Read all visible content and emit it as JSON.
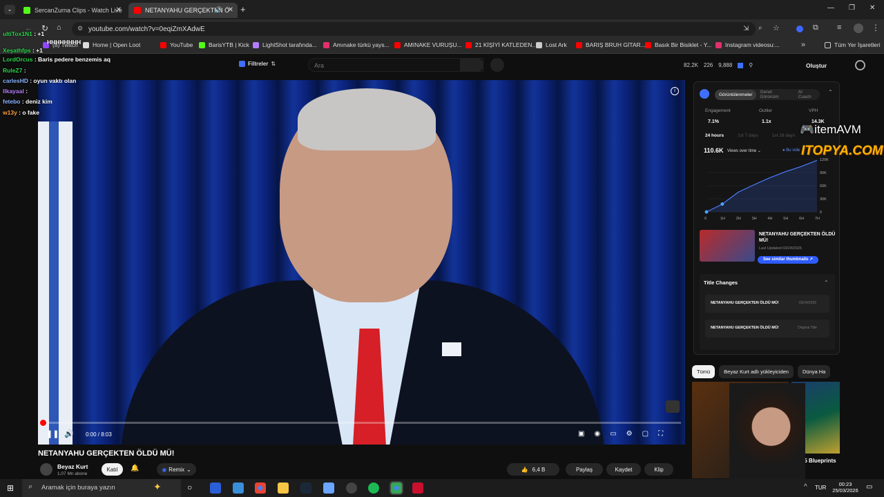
{
  "tabs": [
    {
      "title": "SercanZurna Clips - Watch Live"
    },
    {
      "title": "NETANYAHU GERÇEKTEN Ö"
    }
  ],
  "address": {
    "url": "youtube.com/watch?v=0eqiZmXAdwE"
  },
  "bookmarks": [
    {
      "label": "(8) Twitch",
      "color": "#9146ff"
    },
    {
      "label": "Home | Open Loot",
      "color": "#dddddd"
    },
    {
      "label": "YouTube",
      "color": "#ff0000"
    },
    {
      "label": "BarisYTB | Kick",
      "color": "#53fc18"
    },
    {
      "label": "LightShot tarafında...",
      "color": "#b57cff"
    },
    {
      "label": "Amınake türkü yays...",
      "color": "#e1306c"
    },
    {
      "label": "AMINAKE VURUŞU...",
      "color": "#ff0000"
    },
    {
      "label": "21 KİŞİYİ KATLEDEN...",
      "color": "#ff0000"
    },
    {
      "label": "Lost Ark",
      "color": "#cccccc"
    },
    {
      "label": "BARIŞ BRUH GİTAR...",
      "color": "#ff0000"
    },
    {
      "label": "Basık Bir Bisiklet - Y...",
      "color": "#ff0000"
    },
    {
      "label": "Instagram videosu:...",
      "color": "#e1306c"
    }
  ],
  "bookmarks_all": "Tüm Yer İşaretleri",
  "chat": [
    {
      "user": "ultiTox1N1",
      "msg": " : +1",
      "color": "#2bd44b"
    },
    {
      "user": "",
      "msg": "HHHHHHHH",
      "color": "#ffffff"
    },
    {
      "user": "Xeşathfps",
      "msg": " : +1",
      "color": "#2bd44b"
    },
    {
      "user": "LordOrcus",
      "msg": " : Baris pedere benzemis aq",
      "color": "#2bd44b"
    },
    {
      "user": "RuleZ7",
      "msg": " :",
      "color": "#2bd44b"
    },
    {
      "user": "carlesHD",
      "msg": " : oyun vaktı olan",
      "color": "#8ab4ff"
    },
    {
      "user": "llkayaal",
      "msg": " :",
      "color": "#b47cff"
    },
    {
      "user": "fetebo",
      "msg": " : deniz kim",
      "color": "#8ab4ff"
    },
    {
      "user": "w13y",
      "msg": " : o fake",
      "color": "#ff9f3a"
    }
  ],
  "yt": {
    "filters": "Filtreler",
    "search_placeholder": "Ara",
    "stats": [
      "82.2K",
      "226",
      "9,888"
    ],
    "create": "Oluştur",
    "time": "0:00 / 8:03",
    "title": "NETANYAHU GERÇEKTEN ÖLDÜ MÜ!",
    "channel": "Beyaz Kurt",
    "subs": "1,07 Mn abone",
    "join": "Katıl",
    "remix": "Remix",
    "likes": "6,4 B",
    "share": "Paylaş",
    "save": "Kaydet",
    "clip": "Klip"
  },
  "sidebar": {
    "tabs": [
      "Görüntülenmeler",
      "Genel Görünüm",
      "AI Coach"
    ],
    "metrics": [
      {
        "label": "Engagement",
        "value": "7.1%"
      },
      {
        "label": "Outlier",
        "value": "1.1x"
      },
      {
        "label": "VPH",
        "value": "14.3K"
      }
    ],
    "ranges": [
      "24 hours",
      "1st 7 days",
      "1st 28 days"
    ],
    "views": "110.6K",
    "views_dd": "Views over time",
    "legend": "Bu vide",
    "chart_data": {
      "type": "line",
      "x": [
        "0",
        "1H",
        "2H",
        "3H",
        "4H",
        "5H",
        "6H",
        "7H"
      ],
      "series": [
        {
          "name": "Bu vide",
          "values": [
            0,
            18,
            45,
            62,
            78,
            92,
            104,
            118
          ]
        }
      ],
      "yticks": [
        "120K",
        "90K",
        "60K",
        "30K",
        "0"
      ]
    },
    "thumb_title": "NETANYAHU GERÇEKTEN ÖLDÜ MÜ!",
    "thumb_updated": "Last Updated 03/24/2026",
    "similar_btn": "See similar thumbnails",
    "title_changes": "Title Changes",
    "changes": [
      {
        "title": "NETANYAHU GERÇEKTEN ÖLDÜ MÜ!",
        "date": "03/24/2026"
      },
      {
        "title": "NETANYAHU GERÇEKTEN ÖLDÜ MÜ!",
        "date": "Original Title"
      }
    ]
  },
  "chips": [
    "Tümü",
    "Beyaz Kurt adlı yükleyiciden",
    "Dünya Ha"
  ],
  "rec": {
    "title": "TOP 5 Blueprints ..."
  },
  "overlay": {
    "brand1": "itemAVM",
    "brand2": "ITOPYA.COM"
  },
  "taskbar": {
    "search": "Aramak için buraya yazın",
    "lang": "TUR",
    "time": "00:23",
    "date": "25/03/2026"
  }
}
